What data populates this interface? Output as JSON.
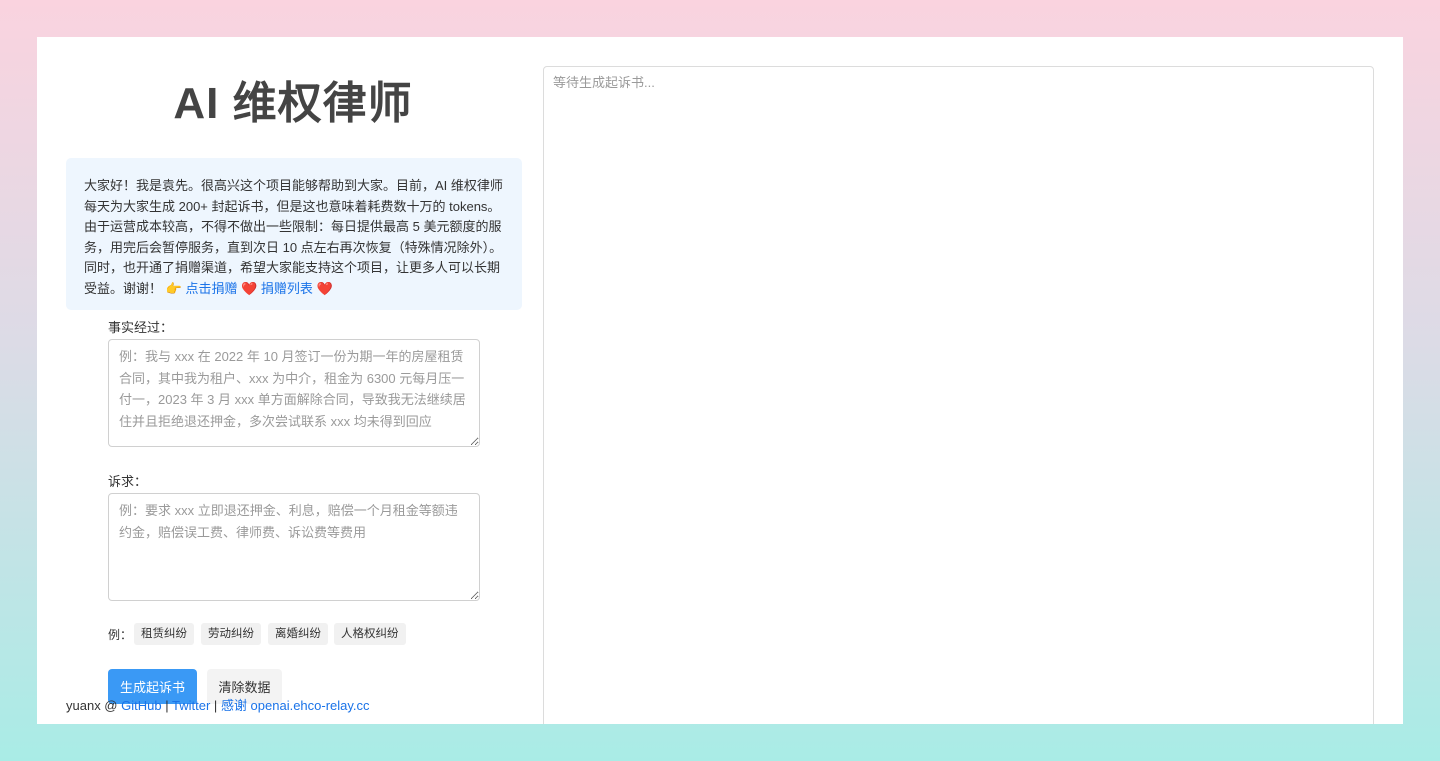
{
  "header": {
    "title": "AI 维权律师"
  },
  "notice": {
    "text": "大家好！我是袁先。很高兴这个项目能够帮助到大家。目前，AI 维权律师每天为大家生成 200+ 封起诉书，但是这也意味着耗费数十万的 tokens。由于运营成本较高，不得不做出一些限制：每日提供最高 5 美元额度的服务，用完后会暂停服务，直到次日 10 点左右再次恢复（特殊情况除外）。同时，也开通了捐赠渠道，希望大家能支持这个项目，让更多人可以长期受益。谢谢！",
    "pointer": "👉",
    "donate_link": "点击捐赠",
    "heart": "❤️",
    "donor_list_link": "捐赠列表"
  },
  "form": {
    "facts_label": "事实经过：",
    "facts_placeholder": "例：我与 xxx 在 2022 年 10 月签订一份为期一年的房屋租赁合同，其中我为租户、xxx 为中介，租金为 6300 元每月压一付一，2023 年 3 月 xxx 单方面解除合同，导致我无法继续居住并且拒绝退还押金，多次尝试联系 xxx 均未得到回应",
    "claims_label": "诉求：",
    "claims_placeholder": "例：要求 xxx 立即退还押金、利息，赔偿一个月租金等额违约金，赔偿误工费、律师费、诉讼费等费用",
    "examples_label": "例：",
    "examples": [
      "租赁纠纷",
      "劳动纠纷",
      "离婚纠纷",
      "人格权纠纷"
    ],
    "generate_button": "生成起诉书",
    "clear_button": "清除数据"
  },
  "footer": {
    "author": "yuanx @",
    "github": "GitHub",
    "sep1": "|",
    "twitter": "Twitter",
    "sep2": "|",
    "thanks": "感谢 openai.ehco-relay.cc"
  },
  "output": {
    "placeholder": "等待生成起诉书..."
  }
}
